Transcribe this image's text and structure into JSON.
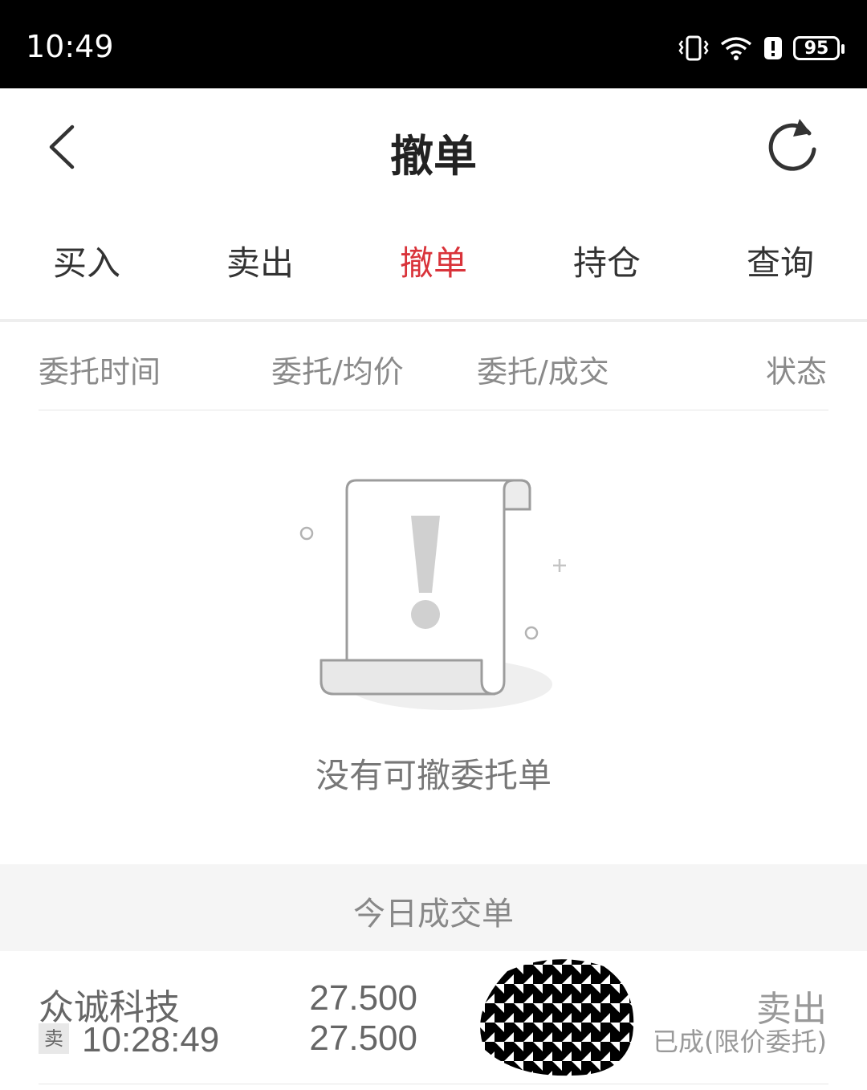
{
  "status_bar": {
    "time": "10:49",
    "battery": "95",
    "icons": [
      "vibrate-icon",
      "wifi-icon",
      "alert-icon",
      "battery-icon"
    ]
  },
  "header": {
    "title": "撤单",
    "back_icon": "chevron-left-icon",
    "refresh_icon": "refresh-icon"
  },
  "tabs": [
    {
      "label": "买入",
      "active": false
    },
    {
      "label": "卖出",
      "active": false
    },
    {
      "label": "撤单",
      "active": true
    },
    {
      "label": "持仓",
      "active": false
    },
    {
      "label": "查询",
      "active": false
    }
  ],
  "columns": {
    "time": "委托时间",
    "price": "委托/均价",
    "qty": "委托/成交",
    "status": "状态"
  },
  "empty_state": {
    "message": "没有可撤委托单",
    "icon": "empty-document-icon"
  },
  "today_deals": {
    "title": "今日成交单",
    "rows": [
      {
        "stock": "众诚科技",
        "side_tag": "卖",
        "time": "10:28:49",
        "price_order": "27.500",
        "price_avg": "27.500",
        "side": "卖出",
        "status": "已成(限价委托)"
      }
    ]
  },
  "colors": {
    "accent": "#d9333a",
    "text_primary": "#222222",
    "text_secondary": "#8a8a8a",
    "band": "#f5f5f5"
  }
}
